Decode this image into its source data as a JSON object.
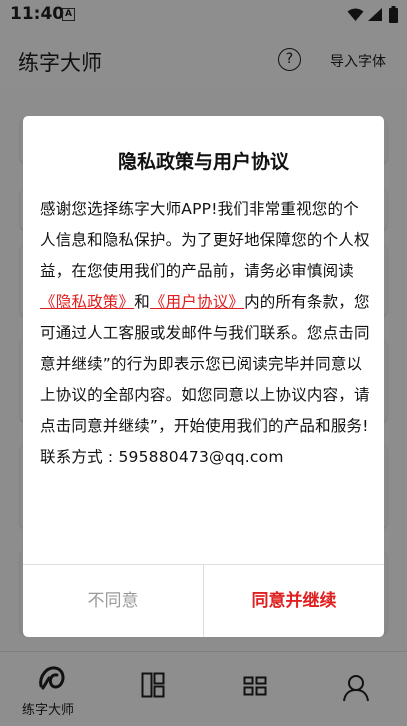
{
  "status_bar": {
    "time": "11:40",
    "notification_badge": "A"
  },
  "app_bar": {
    "title": "练字大师",
    "help_icon": "question-circle-icon",
    "import_label": "导入字体"
  },
  "bottom_nav": {
    "items": [
      {
        "icon": "brush-logo-icon",
        "label": "练字大师"
      },
      {
        "icon": "columns-icon",
        "label": ""
      },
      {
        "icon": "grid-icon",
        "label": ""
      },
      {
        "icon": "person-icon",
        "label": ""
      }
    ]
  },
  "dialog": {
    "title": "隐私政策与用户协议",
    "body_part1": "感谢您选择练字大师APP!我们非常重视您的个人信息和隐私保护。为了更好地保障您的个人权益，在您使用我们的产品前，请务必审慎阅读",
    "privacy_link": "《隐私政策》",
    "and": "和",
    "user_agreement_link": "《用户协议》",
    "body_part2": "内的所有条款，您可通过人工客服或发邮件与我们联系。您点击同意并继续”的行为即表示您已阅读完毕并同意以上协议的全部内容。如您同意以上协议内容，请点击同意并继续”，开始使用我们的产品和服务!",
    "contact": "联系方式 : 595880473@qq.com",
    "disagree_label": "不同意",
    "agree_label": "同意并继续",
    "accent_color": "#e02020"
  }
}
